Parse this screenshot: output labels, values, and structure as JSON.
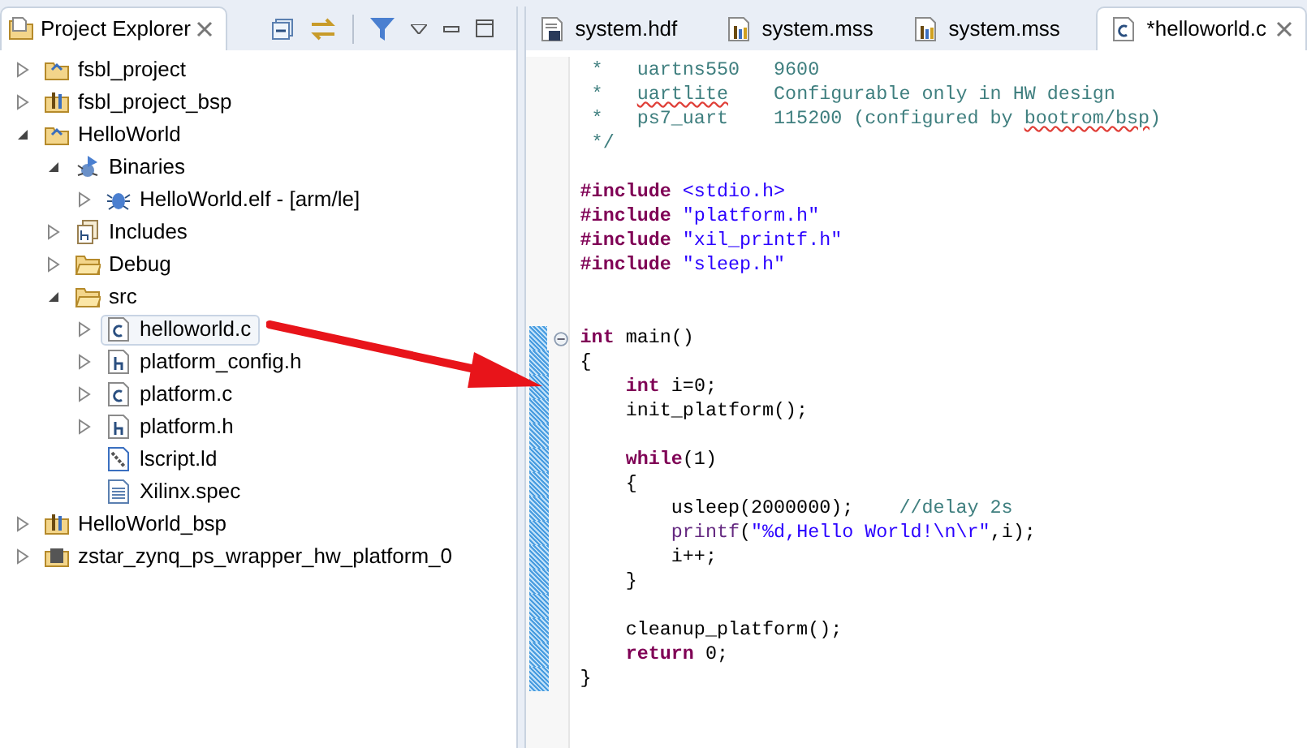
{
  "explorer": {
    "title": "Project Explorer",
    "selected": true,
    "tree": [
      {
        "label": "fsbl_project",
        "kind": "project",
        "expanded": false,
        "selected": false
      },
      {
        "label": "fsbl_project_bsp",
        "kind": "bsp",
        "expanded": false,
        "selected": false
      },
      {
        "label": "HelloWorld",
        "kind": "project",
        "expanded": true,
        "selected": false,
        "children": [
          {
            "label": "Binaries",
            "kind": "binaries",
            "expanded": true,
            "selected": false,
            "children": [
              {
                "label": "HelloWorld.elf - [arm/le]",
                "kind": "elf",
                "expanded": false,
                "selected": false
              }
            ]
          },
          {
            "label": "Includes",
            "kind": "includes",
            "expanded": false,
            "selected": false
          },
          {
            "label": "Debug",
            "kind": "folder",
            "expanded": false,
            "selected": false
          },
          {
            "label": "src",
            "kind": "folder",
            "expanded": true,
            "selected": false,
            "children": [
              {
                "label": "helloworld.c",
                "kind": "c_file",
                "expanded": false,
                "selected": true
              },
              {
                "label": "platform_config.h",
                "kind": "h_file",
                "expanded": false,
                "selected": false
              },
              {
                "label": "platform.c",
                "kind": "c_file",
                "expanded": false,
                "selected": false
              },
              {
                "label": "platform.h",
                "kind": "h_file",
                "expanded": false,
                "selected": false
              },
              {
                "label": "lscript.ld",
                "kind": "linker_script",
                "selected": false
              },
              {
                "label": "Xilinx.spec",
                "kind": "text_file",
                "selected": false
              }
            ]
          }
        ]
      },
      {
        "label": "HelloWorld_bsp",
        "kind": "bsp",
        "expanded": false,
        "selected": false
      },
      {
        "label": "zstar_zynq_ps_wrapper_hw_platform_0",
        "kind": "hw_platform",
        "expanded": false,
        "selected": false
      }
    ]
  },
  "editor": {
    "tabs": [
      {
        "label": "system.hdf",
        "kind": "hdf",
        "selected": false
      },
      {
        "label": "system.mss",
        "kind": "mss",
        "selected": false
      },
      {
        "label": "system.mss",
        "kind": "mss",
        "selected": false
      },
      {
        "label": "*helloworld.c",
        "kind": "c_file",
        "selected": true
      }
    ],
    "lines": [
      {
        "kind": "code",
        "tokens": [
          {
            "kind": "comment",
            "text": " *   uartns550   9600"
          }
        ]
      },
      {
        "kind": "code",
        "tokens": [
          {
            "kind": "comment",
            "text": " *   "
          },
          {
            "kind": "misspelled",
            "text": "uartlite"
          },
          {
            "kind": "comment",
            "text": "    Configurable only in HW design"
          }
        ]
      },
      {
        "kind": "code",
        "tokens": [
          {
            "kind": "comment",
            "text": " *   ps7_uart    115200 (configured by "
          },
          {
            "kind": "misspelled",
            "text": "bootrom/bsp"
          },
          {
            "kind": "comment",
            "text": ")"
          }
        ]
      },
      {
        "kind": "code",
        "tokens": [
          {
            "kind": "comment",
            "text": " */"
          }
        ]
      },
      {
        "kind": "blank"
      },
      {
        "kind": "code",
        "tokens": [
          {
            "kind": "keyword",
            "text": "#include "
          },
          {
            "kind": "string",
            "text": "<stdio.h>"
          }
        ]
      },
      {
        "kind": "code",
        "tokens": [
          {
            "kind": "keyword",
            "text": "#include "
          },
          {
            "kind": "string",
            "text": "\"platform.h\""
          }
        ]
      },
      {
        "kind": "code",
        "tokens": [
          {
            "kind": "keyword",
            "text": "#include "
          },
          {
            "kind": "string",
            "text": "\"xil_printf.h\""
          }
        ]
      },
      {
        "kind": "code",
        "tokens": [
          {
            "kind": "keyword",
            "text": "#include "
          },
          {
            "kind": "string",
            "text": "\"sleep.h\""
          }
        ]
      },
      {
        "kind": "blank"
      },
      {
        "kind": "blank"
      },
      {
        "kind": "code",
        "changed": true,
        "fold_expanded": true,
        "tokens": [
          {
            "kind": "keyword",
            "text": "int"
          },
          {
            "kind": "plain",
            "text": " main()"
          }
        ]
      },
      {
        "kind": "code",
        "changed": true,
        "tokens": [
          {
            "kind": "plain",
            "text": "{"
          }
        ]
      },
      {
        "kind": "code",
        "changed": true,
        "tokens": [
          {
            "kind": "keyword",
            "text": "    int"
          },
          {
            "kind": "plain",
            "text": " i=0;"
          }
        ]
      },
      {
        "kind": "code",
        "changed": true,
        "tokens": [
          {
            "kind": "plain",
            "text": "    init_platform();"
          }
        ]
      },
      {
        "kind": "blank",
        "changed": true
      },
      {
        "kind": "code",
        "changed": true,
        "tokens": [
          {
            "kind": "keyword",
            "text": "    while"
          },
          {
            "kind": "plain",
            "text": "(1)"
          }
        ]
      },
      {
        "kind": "code",
        "changed": true,
        "tokens": [
          {
            "kind": "plain",
            "text": "    {"
          }
        ]
      },
      {
        "kind": "code",
        "changed": true,
        "tokens": [
          {
            "kind": "plain",
            "text": "        usleep(2000000);    "
          },
          {
            "kind": "comment",
            "text": "//delay 2s"
          }
        ]
      },
      {
        "kind": "code",
        "changed": true,
        "tokens": [
          {
            "kind": "function",
            "text": "        printf"
          },
          {
            "kind": "plain",
            "text": "("
          },
          {
            "kind": "string",
            "text": "\"%d,Hello World!\\n\\r\""
          },
          {
            "kind": "plain",
            "text": ",i);"
          }
        ]
      },
      {
        "kind": "code",
        "changed": true,
        "tokens": [
          {
            "kind": "plain",
            "text": "        i++;"
          }
        ]
      },
      {
        "kind": "code",
        "changed": true,
        "tokens": [
          {
            "kind": "plain",
            "text": "    }"
          }
        ]
      },
      {
        "kind": "blank",
        "changed": true
      },
      {
        "kind": "code",
        "changed": true,
        "tokens": [
          {
            "kind": "plain",
            "text": "    cleanup_platform();"
          }
        ]
      },
      {
        "kind": "code",
        "changed": true,
        "tokens": [
          {
            "kind": "keyword",
            "text": "    return"
          },
          {
            "kind": "plain",
            "text": " 0;"
          }
        ]
      },
      {
        "kind": "code",
        "changed": true,
        "tokens": [
          {
            "kind": "plain",
            "text": "}"
          }
        ]
      }
    ]
  }
}
